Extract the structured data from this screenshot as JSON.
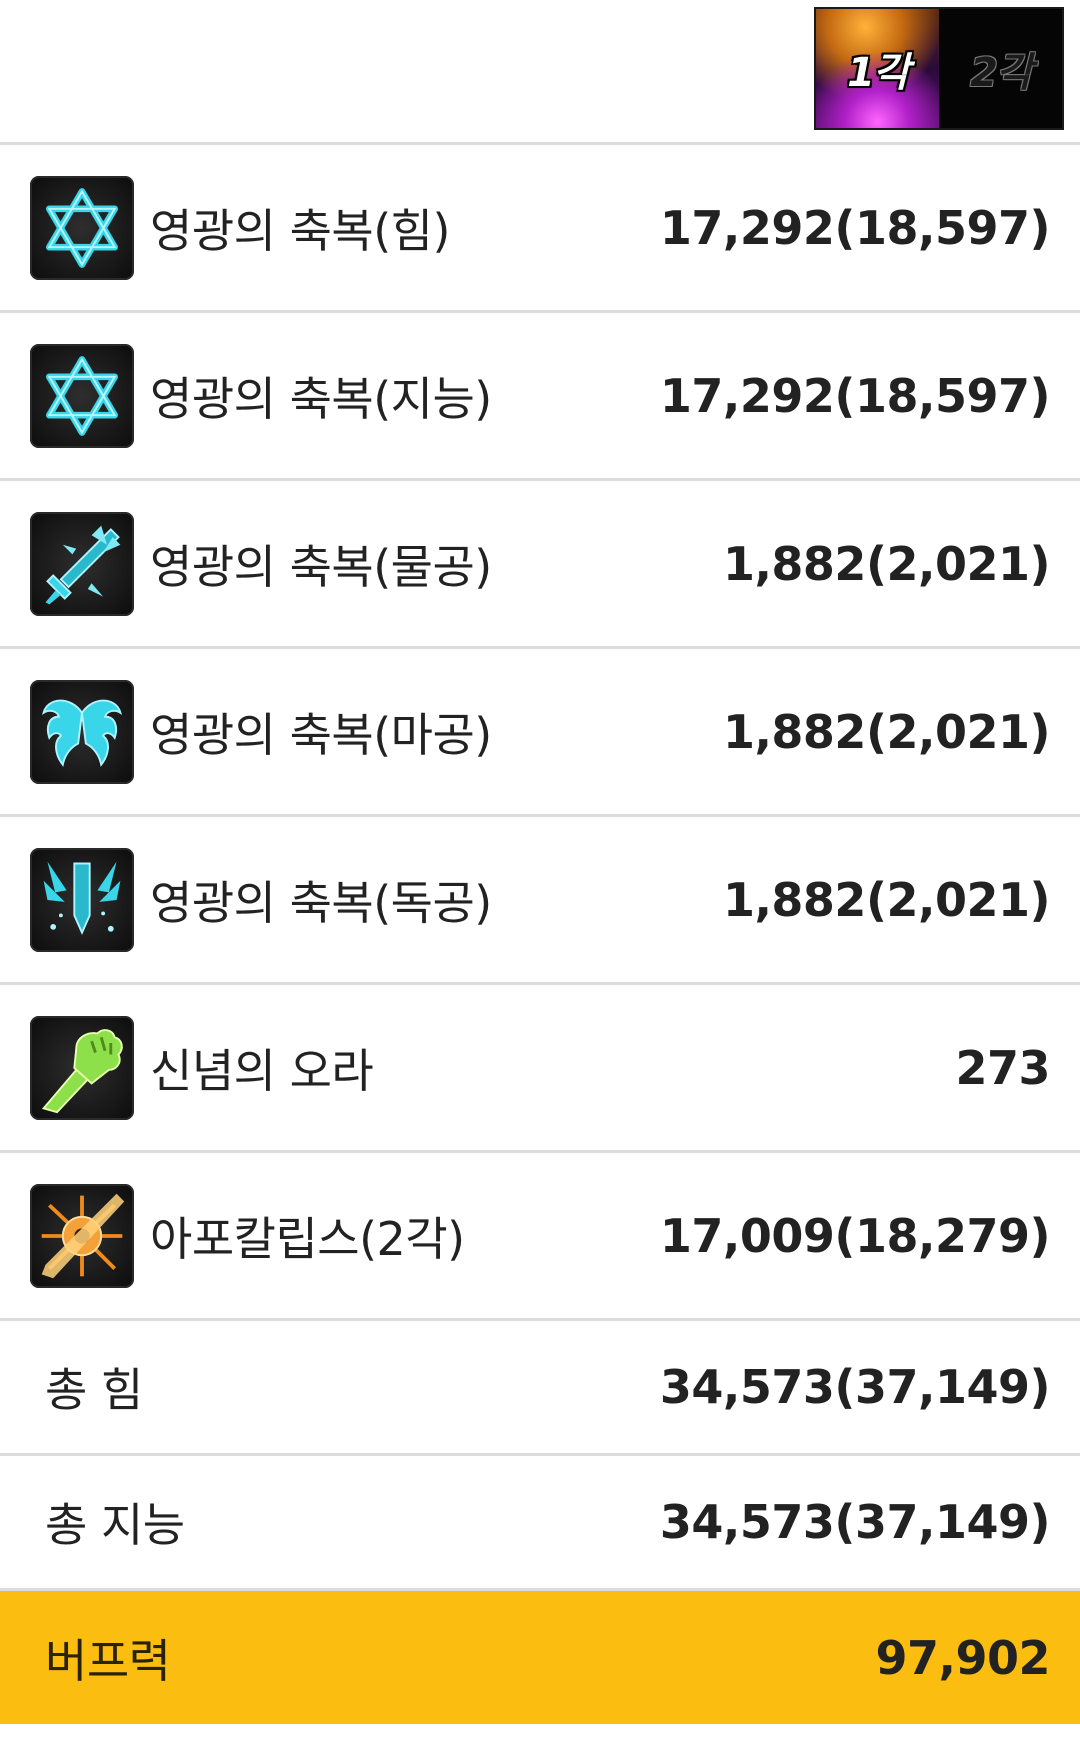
{
  "awakening_toggle": {
    "first_label": "1각",
    "second_label": "2각",
    "selected": "1각"
  },
  "skills": [
    {
      "icon": "hexagram-icon",
      "name": "영광의 축복(힘)",
      "value": "17,292(18,597)"
    },
    {
      "icon": "hexagram-icon",
      "name": "영광의 축복(지능)",
      "value": "17,292(18,597)"
    },
    {
      "icon": "sword-icon",
      "name": "영광의 축복(물공)",
      "value": "1,882(2,021)"
    },
    {
      "icon": "wings-icon",
      "name": "영광의 축복(마공)",
      "value": "1,882(2,021)"
    },
    {
      "icon": "blade-burst-icon",
      "name": "영광의 축복(독공)",
      "value": "1,882(2,021)"
    },
    {
      "icon": "fist-icon",
      "name": "신념의 오라",
      "value": "273"
    },
    {
      "icon": "apocalypse-icon",
      "name": "아포칼립스(2각)",
      "value": "17,009(18,279)"
    }
  ],
  "totals": [
    {
      "name": "총 힘",
      "value": "34,573(37,149)"
    },
    {
      "name": "총 지능",
      "value": "34,573(37,149)"
    }
  ],
  "buff_power": {
    "label": "버프력",
    "value": "97,902"
  },
  "colors": {
    "highlight": "#fbbd10",
    "divider": "#dcdcdc",
    "icon_cyan": "#38d6e8",
    "icon_green": "#8de04a",
    "icon_orange": "#f08a1c"
  }
}
